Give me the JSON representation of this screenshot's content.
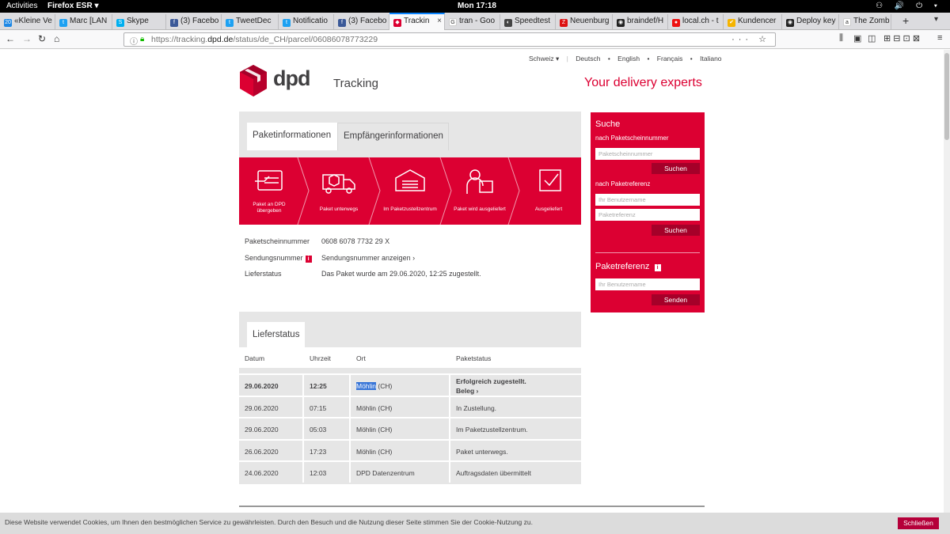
{
  "os": {
    "activities": "Activities",
    "app_menu": "Firefox ESR ▾",
    "clock": "Mon 17:18",
    "tray": "⚇ 🔊 ⏻ ▾"
  },
  "tabs": [
    {
      "label": "«Kleine Ve",
      "color": "#1e88e5",
      "glyph": "20"
    },
    {
      "label": "Marc [LAN",
      "color": "#1da1f2",
      "glyph": "t"
    },
    {
      "label": "Skype",
      "color": "#00aff0",
      "glyph": "S"
    },
    {
      "label": "(3) Facebo",
      "color": "#3b5998",
      "glyph": "f"
    },
    {
      "label": "TweetDec",
      "color": "#1da1f2",
      "glyph": "t"
    },
    {
      "label": "Notificatio",
      "color": "#1da1f2",
      "glyph": "t"
    },
    {
      "label": "(3) Facebo",
      "color": "#3b5998",
      "glyph": "f"
    },
    {
      "label": "Trackin",
      "color": "#dc0032",
      "glyph": "◆",
      "active": true
    },
    {
      "label": "tran - Goo",
      "color": "#ffffff",
      "glyph": "G"
    },
    {
      "label": "Speedtest",
      "color": "#444444",
      "glyph": "◐"
    },
    {
      "label": "Neuenburg",
      "color": "#d11",
      "glyph": "Z"
    },
    {
      "label": "braindef/H",
      "color": "#222222",
      "glyph": "◉"
    },
    {
      "label": "local.ch - t",
      "color": "#e11",
      "glyph": "●"
    },
    {
      "label": "Kundencer",
      "color": "#f5b400",
      "glyph": "✔"
    },
    {
      "label": "Deploy key",
      "color": "#222222",
      "glyph": "◉"
    },
    {
      "label": "The Zomb",
      "color": "#ffffff",
      "glyph": "a"
    }
  ],
  "new_tab": "+",
  "tab_scroll": "▾",
  "nav": {
    "back": "←",
    "forward": "→",
    "reload": "↻",
    "home": "⌂"
  },
  "url": {
    "prefix": "https://tracking.",
    "host": "dpd.de",
    "path": "/status/de_CH/parcel/06086078773229",
    "actions": "··· ☆"
  },
  "toolbar": {
    "library": "⫼",
    "sidebar": "▣",
    "reader": "◫",
    "extensions": "⊞ ⊟ ⊡ ⊠",
    "menu": "≡"
  },
  "page": {
    "lang": {
      "country": "Schweiz ▾",
      "de": "Deutsch",
      "en": "English",
      "fr": "Français",
      "it": "Italiano",
      "sep": "•"
    },
    "logo_text": "dpd",
    "title": "Tracking",
    "slogan": "Your delivery experts",
    "tab_paket": "Paketinformationen",
    "tab_empf": "Empfängerinformationen",
    "steps": [
      {
        "label1": "Paket an DPD",
        "label2": "übergeben",
        "icon": "parcel-handover-icon"
      },
      {
        "label1": "Paket unterwegs",
        "label2": "",
        "icon": "truck-icon"
      },
      {
        "label1": "Im Paketzustellzentrum",
        "label2": "",
        "icon": "depot-icon"
      },
      {
        "label1": "Paket wird ausgeliefert",
        "label2": "",
        "icon": "courier-icon"
      },
      {
        "label1": "Ausgeliefert",
        "label2": "",
        "icon": "checkmark-icon"
      }
    ],
    "info": {
      "paketschein_label": "Paketscheinnummer",
      "paketschein_value": "0608 6078 7732 29 X",
      "sendung_label": "Sendungsnummer",
      "sendung_value": "Sendungsnummer anzeigen  ›",
      "status_label": "Lieferstatus",
      "status_value": "Das Paket wurde am 29.06.2020, 12:25 zugestellt.",
      "info_glyph": "i"
    },
    "sidebar": {
      "title": "Suche",
      "sub1": "nach Paketscheinnummer",
      "ph1": "Paketscheinnummer",
      "btn1": "Suchen",
      "sub2": "nach Paketreferenz",
      "ph2": "Ihr Benutzername",
      "ph3": "Paketreferenz",
      "btn2": "Suchen",
      "title2": "Paketreferenz",
      "ph4": "Ihr Benutzername",
      "btn3": "Senden",
      "info_glyph": "i"
    },
    "status_tab": "Lieferstatus",
    "table": {
      "headers": [
        "Datum",
        "Uhrzeit",
        "Ort",
        "Paketstatus"
      ],
      "rows": [
        {
          "date": "29.06.2020",
          "time": "12:25",
          "place_hl": "Möhlin",
          "place_rest": " (CH)",
          "status": "Erfolgreich zugestellt.",
          "extra": "Beleg  ›"
        },
        {
          "date": "29.06.2020",
          "time": "07:15",
          "place": "Möhlin (CH)",
          "status": "In Zustellung."
        },
        {
          "date": "29.06.2020",
          "time": "05:03",
          "place": "Möhlin (CH)",
          "status": "Im Paketzustellzentrum."
        },
        {
          "date": "26.06.2020",
          "time": "17:23",
          "place": "Möhlin (CH)",
          "status": "Paket unterwegs."
        },
        {
          "date": "24.06.2020",
          "time": "12:03",
          "place": "DPD Datenzentrum",
          "status": "Auftragsdaten übermittelt"
        }
      ]
    },
    "cookie": {
      "text": "Diese Website verwendet Cookies, um Ihnen den bestmöglichen Service zu gewährleisten. Durch den Besuch und die Nutzung dieser Seite stimmen Sie der Cookie-Nutzung zu.",
      "button": "Schließen"
    }
  }
}
